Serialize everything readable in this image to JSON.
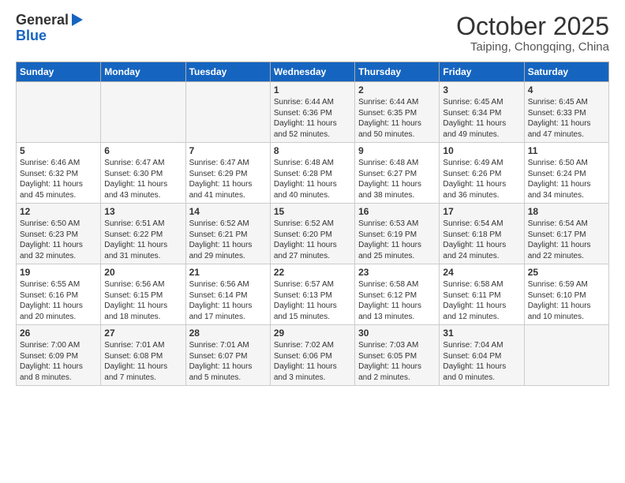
{
  "logo": {
    "general": "General",
    "blue": "Blue"
  },
  "header": {
    "month": "October 2025",
    "location": "Taiping, Chongqing, China"
  },
  "days_of_week": [
    "Sunday",
    "Monday",
    "Tuesday",
    "Wednesday",
    "Thursday",
    "Friday",
    "Saturday"
  ],
  "weeks": [
    [
      {
        "day": "",
        "content": ""
      },
      {
        "day": "",
        "content": ""
      },
      {
        "day": "",
        "content": ""
      },
      {
        "day": "1",
        "content": "Sunrise: 6:44 AM\nSunset: 6:36 PM\nDaylight: 11 hours\nand 52 minutes."
      },
      {
        "day": "2",
        "content": "Sunrise: 6:44 AM\nSunset: 6:35 PM\nDaylight: 11 hours\nand 50 minutes."
      },
      {
        "day": "3",
        "content": "Sunrise: 6:45 AM\nSunset: 6:34 PM\nDaylight: 11 hours\nand 49 minutes."
      },
      {
        "day": "4",
        "content": "Sunrise: 6:45 AM\nSunset: 6:33 PM\nDaylight: 11 hours\nand 47 minutes."
      }
    ],
    [
      {
        "day": "5",
        "content": "Sunrise: 6:46 AM\nSunset: 6:32 PM\nDaylight: 11 hours\nand 45 minutes."
      },
      {
        "day": "6",
        "content": "Sunrise: 6:47 AM\nSunset: 6:30 PM\nDaylight: 11 hours\nand 43 minutes."
      },
      {
        "day": "7",
        "content": "Sunrise: 6:47 AM\nSunset: 6:29 PM\nDaylight: 11 hours\nand 41 minutes."
      },
      {
        "day": "8",
        "content": "Sunrise: 6:48 AM\nSunset: 6:28 PM\nDaylight: 11 hours\nand 40 minutes."
      },
      {
        "day": "9",
        "content": "Sunrise: 6:48 AM\nSunset: 6:27 PM\nDaylight: 11 hours\nand 38 minutes."
      },
      {
        "day": "10",
        "content": "Sunrise: 6:49 AM\nSunset: 6:26 PM\nDaylight: 11 hours\nand 36 minutes."
      },
      {
        "day": "11",
        "content": "Sunrise: 6:50 AM\nSunset: 6:24 PM\nDaylight: 11 hours\nand 34 minutes."
      }
    ],
    [
      {
        "day": "12",
        "content": "Sunrise: 6:50 AM\nSunset: 6:23 PM\nDaylight: 11 hours\nand 32 minutes."
      },
      {
        "day": "13",
        "content": "Sunrise: 6:51 AM\nSunset: 6:22 PM\nDaylight: 11 hours\nand 31 minutes."
      },
      {
        "day": "14",
        "content": "Sunrise: 6:52 AM\nSunset: 6:21 PM\nDaylight: 11 hours\nand 29 minutes."
      },
      {
        "day": "15",
        "content": "Sunrise: 6:52 AM\nSunset: 6:20 PM\nDaylight: 11 hours\nand 27 minutes."
      },
      {
        "day": "16",
        "content": "Sunrise: 6:53 AM\nSunset: 6:19 PM\nDaylight: 11 hours\nand 25 minutes."
      },
      {
        "day": "17",
        "content": "Sunrise: 6:54 AM\nSunset: 6:18 PM\nDaylight: 11 hours\nand 24 minutes."
      },
      {
        "day": "18",
        "content": "Sunrise: 6:54 AM\nSunset: 6:17 PM\nDaylight: 11 hours\nand 22 minutes."
      }
    ],
    [
      {
        "day": "19",
        "content": "Sunrise: 6:55 AM\nSunset: 6:16 PM\nDaylight: 11 hours\nand 20 minutes."
      },
      {
        "day": "20",
        "content": "Sunrise: 6:56 AM\nSunset: 6:15 PM\nDaylight: 11 hours\nand 18 minutes."
      },
      {
        "day": "21",
        "content": "Sunrise: 6:56 AM\nSunset: 6:14 PM\nDaylight: 11 hours\nand 17 minutes."
      },
      {
        "day": "22",
        "content": "Sunrise: 6:57 AM\nSunset: 6:13 PM\nDaylight: 11 hours\nand 15 minutes."
      },
      {
        "day": "23",
        "content": "Sunrise: 6:58 AM\nSunset: 6:12 PM\nDaylight: 11 hours\nand 13 minutes."
      },
      {
        "day": "24",
        "content": "Sunrise: 6:58 AM\nSunset: 6:11 PM\nDaylight: 11 hours\nand 12 minutes."
      },
      {
        "day": "25",
        "content": "Sunrise: 6:59 AM\nSunset: 6:10 PM\nDaylight: 11 hours\nand 10 minutes."
      }
    ],
    [
      {
        "day": "26",
        "content": "Sunrise: 7:00 AM\nSunset: 6:09 PM\nDaylight: 11 hours\nand 8 minutes."
      },
      {
        "day": "27",
        "content": "Sunrise: 7:01 AM\nSunset: 6:08 PM\nDaylight: 11 hours\nand 7 minutes."
      },
      {
        "day": "28",
        "content": "Sunrise: 7:01 AM\nSunset: 6:07 PM\nDaylight: 11 hours\nand 5 minutes."
      },
      {
        "day": "29",
        "content": "Sunrise: 7:02 AM\nSunset: 6:06 PM\nDaylight: 11 hours\nand 3 minutes."
      },
      {
        "day": "30",
        "content": "Sunrise: 7:03 AM\nSunset: 6:05 PM\nDaylight: 11 hours\nand 2 minutes."
      },
      {
        "day": "31",
        "content": "Sunrise: 7:04 AM\nSunset: 6:04 PM\nDaylight: 11 hours\nand 0 minutes."
      },
      {
        "day": "",
        "content": ""
      }
    ]
  ]
}
